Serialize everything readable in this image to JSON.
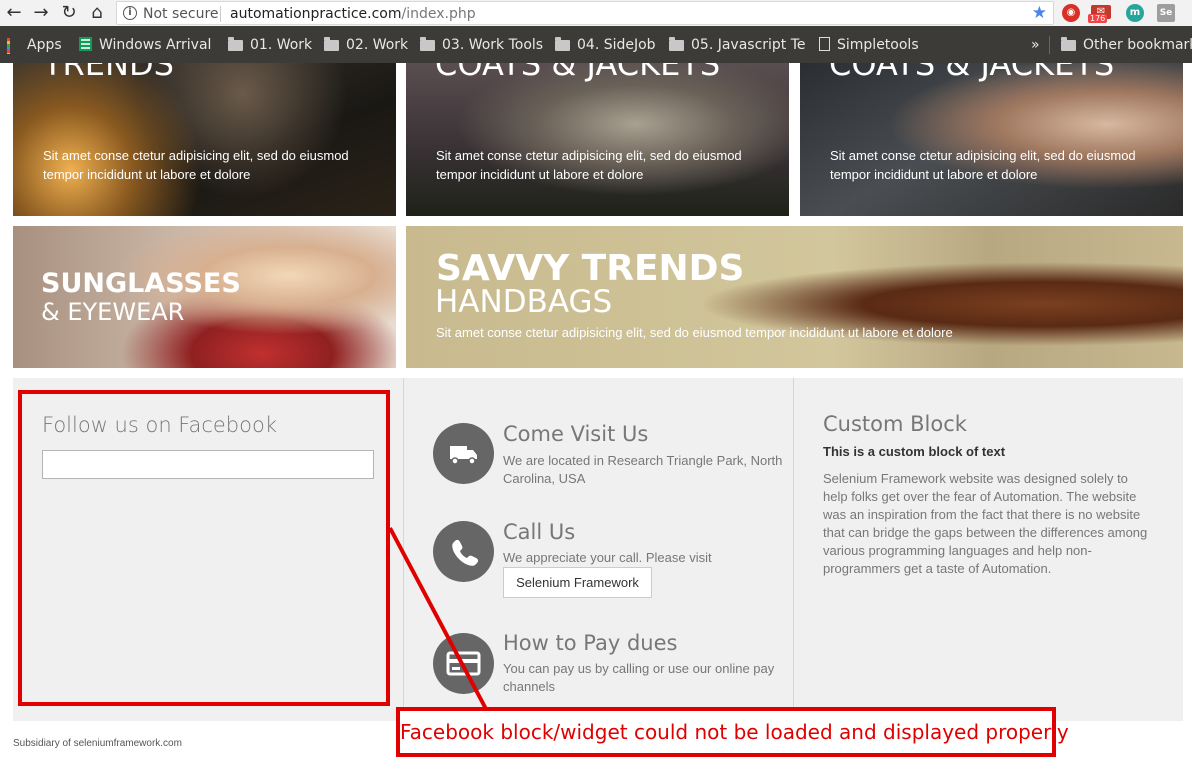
{
  "browser": {
    "security_label": "Not secure",
    "url_host": "automationpractice.com",
    "url_path": "/index.php",
    "extension_badge": "176",
    "extension_m": "m",
    "extension_se": "Se",
    "bookmarks": [
      {
        "label": "Apps",
        "icon": "apps-grid-icon"
      },
      {
        "label": "Windows Arrival",
        "icon": "sheets-icon"
      },
      {
        "label": "01. Work",
        "icon": "folder-icon"
      },
      {
        "label": "02. Work",
        "icon": "folder-icon"
      },
      {
        "label": "03. Work Tools",
        "icon": "folder-icon"
      },
      {
        "label": "04. SideJob",
        "icon": "folder-icon"
      },
      {
        "label": "05. Javascript Te",
        "icon": "folder-icon"
      },
      {
        "label": "Simpletools",
        "icon": "page-icon"
      }
    ],
    "overflow_label": "»",
    "other_bookmarks": "Other bookmarks"
  },
  "banners": {
    "top": [
      {
        "title": "TRENDS",
        "desc": "Sit amet conse ctetur adipisicing elit, sed do eiusmod tempor incididunt ut labore et dolore"
      },
      {
        "title": "COATS & JACKETS",
        "desc": "Sit amet conse ctetur adipisicing elit, sed do eiusmod tempor incididunt ut labore et dolore"
      },
      {
        "title": "COATS & JACKETS",
        "desc": "Sit amet conse ctetur adipisicing elit, sed do eiusmod tempor incididunt ut labore et dolore"
      }
    ],
    "sunglasses": {
      "line1": "SUNGLASSES",
      "line2": "& EYEWEAR"
    },
    "handbags": {
      "line1": "SAVVY TRENDS",
      "line2": "HANDBAGS",
      "desc": "Sit amet conse ctetur adipisicing elit, sed do eiusmod tempor incididunt ut labore et dolore"
    }
  },
  "facebook": {
    "title": "Follow us on Facebook"
  },
  "contact": [
    {
      "title": "Come Visit Us",
      "text": "We are located in Research Triangle Park, North Carolina, USA",
      "icon": "truck-icon"
    },
    {
      "title": "Call Us",
      "text": "We appreciate your call. Please visit",
      "icon": "phone-icon",
      "button": "Selenium Framework"
    },
    {
      "title": "How to Pay dues",
      "text": "You can pay us by calling or use our online pay channels",
      "icon": "credit-card-icon"
    }
  ],
  "custom_block": {
    "title": "Custom Block",
    "subtitle": "This is a custom block of text",
    "text": "Selenium Framework website was designed solely to help folks get over the fear of Automation. The website was an inspiration from the fact that there is no website that can bridge the gaps between the differences among various programming languages and help non-programmers get a taste of Automation."
  },
  "copyright": "Subsidiary of seleniumframework.com",
  "annotation": {
    "callout": "Facebook block/widget could not be loaded and displayed properly",
    "color": "#e00000"
  }
}
